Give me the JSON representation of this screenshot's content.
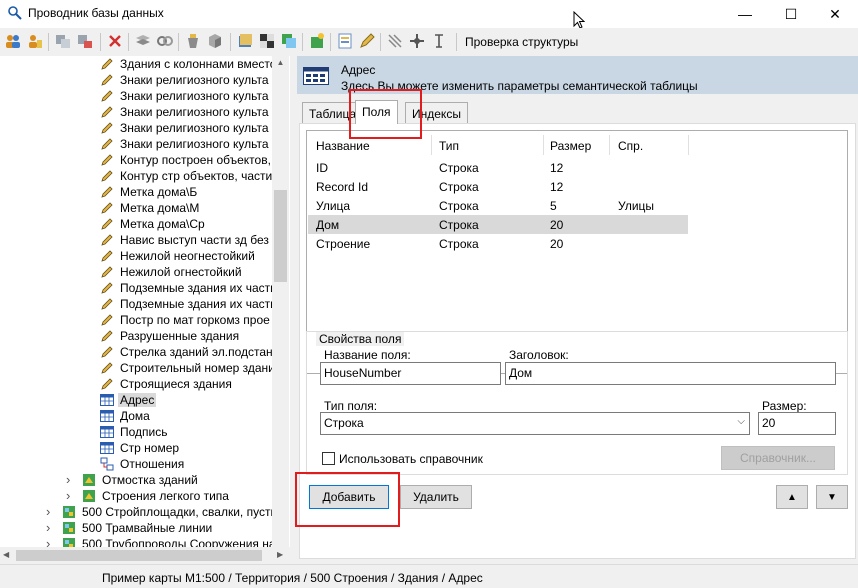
{
  "window": {
    "title": "Проводник базы данных",
    "minimize": "—",
    "maximize": "☐",
    "close": "✕"
  },
  "toolbar": {
    "structure_check_label": "Проверка структуры"
  },
  "tree": {
    "items": [
      {
        "label": "Здания с колоннами вместо",
        "icon": "pencil-icon"
      },
      {
        "label": "Знаки религиозного культа",
        "icon": "pencil-icon"
      },
      {
        "label": "Знаки религиозного культа",
        "icon": "pencil-icon"
      },
      {
        "label": "Знаки религиозного культа",
        "icon": "pencil-icon"
      },
      {
        "label": "Знаки религиозного культа",
        "icon": "pencil-icon"
      },
      {
        "label": "Знаки религиозного культа",
        "icon": "pencil-icon"
      },
      {
        "label": "Контур построен объектов,",
        "icon": "pencil-icon"
      },
      {
        "label": "Контур стр объектов, части",
        "icon": "pencil-icon"
      },
      {
        "label": "Метка дома\\Б",
        "icon": "pencil-icon"
      },
      {
        "label": "Метка дома\\М",
        "icon": "pencil-icon"
      },
      {
        "label": "Метка дома\\Ср",
        "icon": "pencil-icon"
      },
      {
        "label": "Навис выступ части зд без о",
        "icon": "pencil-icon"
      },
      {
        "label": "Нежилой неогнестойкий",
        "icon": "pencil-icon"
      },
      {
        "label": "Нежилой огнестойкий",
        "icon": "pencil-icon"
      },
      {
        "label": "Подземные здания их части",
        "icon": "pencil-icon"
      },
      {
        "label": "Подземные здания их части",
        "icon": "pencil-icon"
      },
      {
        "label": "Постр по мат горкомз прое",
        "icon": "pencil-icon"
      },
      {
        "label": "Разрушенные здания",
        "icon": "pencil-icon"
      },
      {
        "label": "Стрелка зданий эл.подстанц",
        "icon": "pencil-icon"
      },
      {
        "label": "Строительный номер здани",
        "icon": "pencil-icon"
      },
      {
        "label": "Строящиеся здания",
        "icon": "pencil-icon"
      },
      {
        "label": "Адрес",
        "icon": "table-icon",
        "selected": true
      },
      {
        "label": "Дома",
        "icon": "table-icon"
      },
      {
        "label": "Подпись",
        "icon": "table-icon"
      },
      {
        "label": "Стр номер",
        "icon": "table-icon"
      },
      {
        "label": "Отношения",
        "icon": "relations-icon"
      },
      {
        "label": "Отмостка зданий",
        "icon": "layer-icon"
      },
      {
        "label": "Строения легкого типа",
        "icon": "layer-icon"
      },
      {
        "label": "500 Стройплощадки, свалки, пусть",
        "icon": "map-layer-icon"
      },
      {
        "label": "500 Трамвайные линии",
        "icon": "map-layer-icon"
      },
      {
        "label": "500 Трубопроводы Сооружения на",
        "icon": "map-layer-icon"
      }
    ]
  },
  "header": {
    "title": "Адрес",
    "subtitle": "Здесь Вы можете изменить параметры семантической таблицы"
  },
  "tabs": [
    {
      "label": "Таблица"
    },
    {
      "label": "Поля"
    },
    {
      "label": "Индексы"
    }
  ],
  "grid": {
    "columns": [
      "Название",
      "Тип",
      "Размер",
      "Спр."
    ],
    "rows": [
      {
        "name": "ID",
        "type": "Строка",
        "size": "12",
        "ref": ""
      },
      {
        "name": "Record Id",
        "type": "Строка",
        "size": "12",
        "ref": ""
      },
      {
        "name": "Улица",
        "type": "Строка",
        "size": "5",
        "ref": "Улицы"
      },
      {
        "name": "Дом",
        "type": "Строка",
        "size": "20",
        "ref": "",
        "selected": true
      },
      {
        "name": "Строение",
        "type": "Строка",
        "size": "20",
        "ref": ""
      }
    ]
  },
  "props": {
    "group_label": "Свойства поля",
    "field_name_label": "Название поля:",
    "field_name_value": "HouseNumber",
    "caption_label": "Заголовок:",
    "caption_value": "Дом",
    "type_label": "Тип поля:",
    "type_value": "Строка",
    "size_label": "Размер:",
    "size_value": "20",
    "use_dict_label": "Использовать справочник",
    "use_dict_checked": false,
    "dict_button": "Справочник..."
  },
  "buttons": {
    "add": "Добавить",
    "delete": "Удалить",
    "up": "▲",
    "down": "▼"
  },
  "status": {
    "text": "Пример карты М1:500 / Территория / 500 Строения / Здания / Адрес"
  }
}
